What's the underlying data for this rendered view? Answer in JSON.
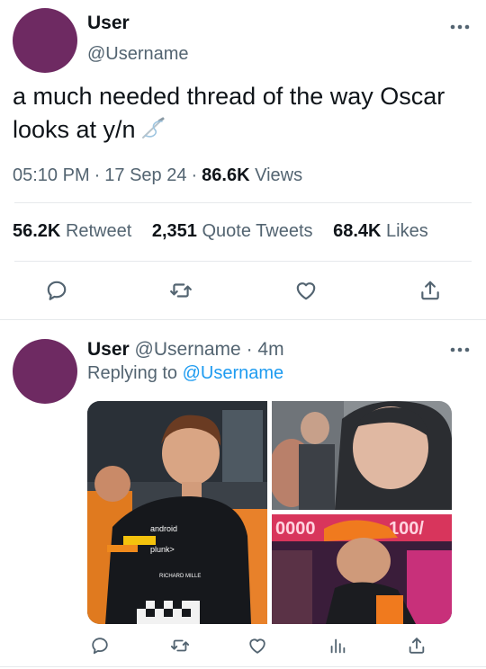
{
  "tweet": {
    "display_name": "User",
    "handle": "@Username",
    "text": "a much needed thread of the way Oscar looks at y/n",
    "text_emoji": "needle-emoji",
    "time": "05:10 PM",
    "date": "17 Sep 24",
    "separator": "·",
    "views_count": "86.6K",
    "views_label": "Views",
    "stats": {
      "retweets_count": "56.2K",
      "retweets_label": "Retweet",
      "quotes_count": "2,351",
      "quotes_label": "Quote Tweets",
      "likes_count": "68.4K",
      "likes_label": "Likes"
    },
    "actions": [
      "reply-icon",
      "retweet-icon",
      "like-icon",
      "share-icon"
    ]
  },
  "reply": {
    "display_name": "User",
    "handle": "@Username",
    "separator": "·",
    "time_ago": "4m",
    "replying_to_label": "Replying to",
    "replying_to_handle": "@Username",
    "photos": [
      "photo-driver-smiling-in-team-suit",
      "photo-driver-selfie-in-hood",
      "photo-driver-in-orange-cap"
    ],
    "actions": [
      "reply-icon",
      "retweet-icon",
      "like-icon",
      "analytics-icon",
      "share-icon"
    ]
  },
  "colors": {
    "avatar": "#6e2a62",
    "link": "#1d9bf0",
    "muted": "#536471",
    "text": "#0f1419",
    "divider": "#e6e9ec"
  }
}
